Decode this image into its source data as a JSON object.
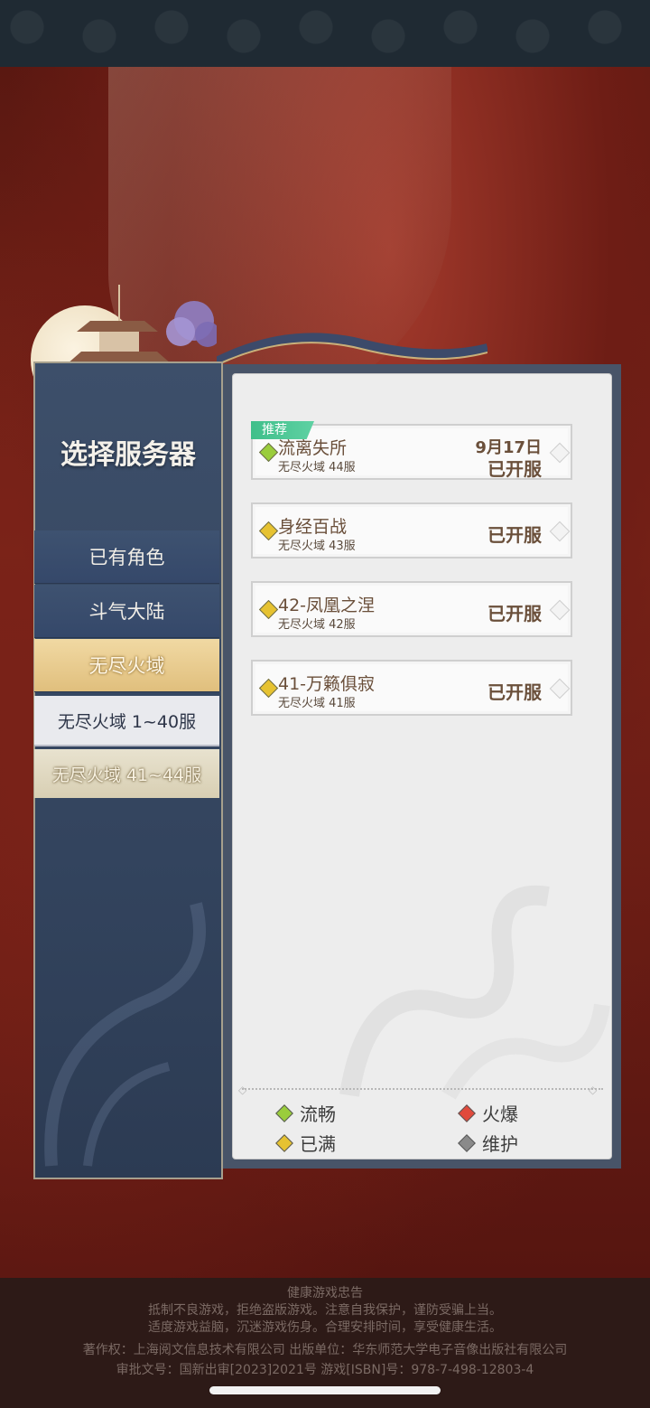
{
  "left_panel": {
    "title": "选择服务器",
    "nav_items": [
      "已有角色",
      "斗气大陆",
      "无尽火域"
    ],
    "active_index": 2,
    "sub_items": [
      "无尽火域 1~40服",
      "无尽火域 41~44服"
    ],
    "selected_sub_index": 1
  },
  "servers": [
    {
      "tag": "推荐",
      "name": "流离失所",
      "sub": "无尽火域 44服",
      "date": "9月17日",
      "status": "已开服",
      "state": "流畅"
    },
    {
      "tag": "",
      "name": "身经百战",
      "sub": "无尽火域 43服",
      "date": "",
      "status": "已开服",
      "state": "已满"
    },
    {
      "tag": "",
      "name": "42-凤凰之涅",
      "sub": "无尽火域 42服",
      "date": "",
      "status": "已开服",
      "state": "已满"
    },
    {
      "tag": "",
      "name": "41-万籁俱寂",
      "sub": "无尽火域 41服",
      "date": "",
      "status": "已开服",
      "state": "已满"
    }
  ],
  "legend": [
    {
      "label": "流畅",
      "color": "#9acd3c"
    },
    {
      "label": "火爆",
      "color": "#e04a3c"
    },
    {
      "label": "已满",
      "color": "#e6c231"
    },
    {
      "label": "维护",
      "color": "#8a8a8a"
    }
  ],
  "footer": {
    "line1": "健康游戏忠告",
    "line2": "抵制不良游戏，拒绝盗版游戏。注意自我保护，谨防受骗上当。",
    "line3": "适度游戏益脑，沉迷游戏伤身。合理安排时间，享受健康生活。",
    "line4": "著作权：上海阅文信息技术有限公司 出版单位：华东师范大学电子音像出版社有限公司",
    "line5": "审批文号：国新出审[2023]2021号 游戏[ISBN]号：978-7-498-12803-4"
  },
  "colors": {
    "accent_gold": "#e6c98a",
    "panel_blue": "#3d4f6a",
    "recommend_green": "#3fbf8a"
  }
}
